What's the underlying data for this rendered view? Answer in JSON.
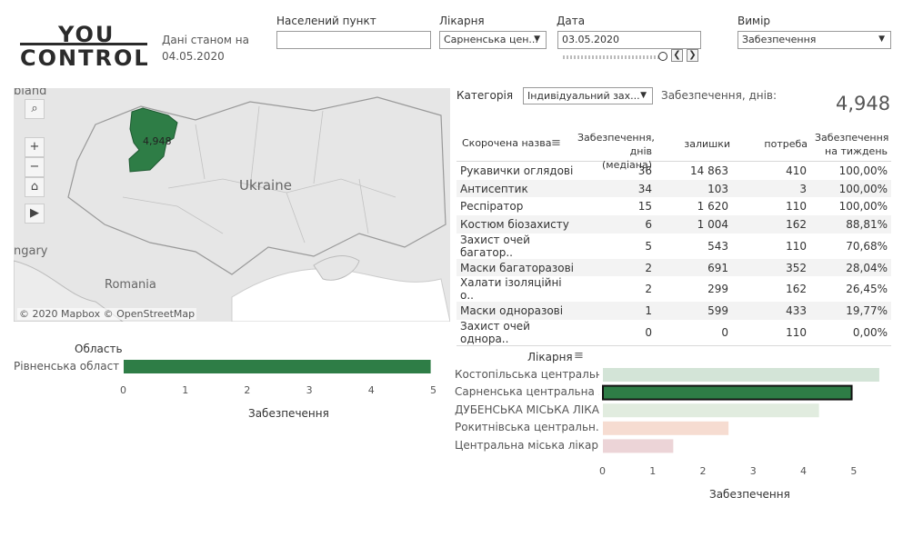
{
  "logo": {
    "line1": "YOU",
    "line2": "CONTROL"
  },
  "as_of": {
    "line1": "Дані станом на",
    "line2": "04.05.2020"
  },
  "filters": {
    "settlement": {
      "label": "Населений пункт",
      "value": ""
    },
    "hospital": {
      "label": "Лікарня",
      "value": "Сарненська цен..."
    },
    "date": {
      "label": "Дата",
      "value": "03.05.2020"
    },
    "measure": {
      "label": "Вимір",
      "value": "Забезпечення"
    },
    "date_slider_fraction": 0.95
  },
  "map": {
    "region_value": "4,948",
    "country_label": "Ukraine",
    "labels": [
      "bland",
      "Romania",
      "ngary"
    ],
    "attribution": "© 2020 Mapbox © OpenStreetMap",
    "region_color": "#2e7d46"
  },
  "category": {
    "label": "Категорія",
    "value": "Індивідуальний зах...",
    "metric_label": "Забезпечення, днів:",
    "metric_value": "4,948"
  },
  "table": {
    "headers": [
      "Скорочена назва",
      "Забезпечення, днів (медіана)",
      "залишки",
      "потреба",
      "Забезпечення на тиждень"
    ],
    "rows": [
      [
        "Рукавички оглядові",
        "36",
        "14 863",
        "410",
        "100,00%"
      ],
      [
        "Антисептик",
        "34",
        "103",
        "3",
        "100,00%"
      ],
      [
        "Респіратор",
        "15",
        "1 620",
        "110",
        "100,00%"
      ],
      [
        "Костюм біозахисту",
        "6",
        "1 004",
        "162",
        "88,81%"
      ],
      [
        "Захист очей багатор..",
        "5",
        "543",
        "110",
        "70,68%"
      ],
      [
        "Маски багаторазові",
        "2",
        "691",
        "352",
        "28,04%"
      ],
      [
        "Халати ізоляційні о..",
        "2",
        "299",
        "162",
        "26,45%"
      ],
      [
        "Маски одноразові",
        "1",
        "599",
        "433",
        "19,77%"
      ],
      [
        "Захист очей однора..",
        "0",
        "0",
        "110",
        "0,00%"
      ]
    ]
  },
  "chart_data": [
    {
      "type": "bar",
      "orientation": "horizontal",
      "title": "Область",
      "categories": [
        "Рівненська область"
      ],
      "values": [
        4.95
      ],
      "xlabel": "Забезпечення",
      "xlim": [
        0,
        5
      ],
      "ticks": [
        "0",
        "1",
        "2",
        "3",
        "4",
        "5"
      ],
      "colors": [
        "#2e7d46"
      ]
    },
    {
      "type": "bar",
      "orientation": "horizontal",
      "title": "Лікарня",
      "categories": [
        "Костопільська центральн..",
        "Сарненська центральна ..",
        "ДУБЕНСЬКА МІСЬКА ЛІКА..",
        "Рокитнівська центральн..",
        "Центральна міська лікар.."
      ],
      "values": [
        5.5,
        4.95,
        4.3,
        2.5,
        1.4
      ],
      "xlabel": "Забезпечення",
      "xlim": [
        0,
        5.7
      ],
      "ticks": [
        "0",
        "1",
        "2",
        "3",
        "4",
        "5"
      ],
      "colors": [
        "#d3e4d7",
        "#2e7d46",
        "#e1ecdf",
        "#f6dcd1",
        "#ecd4d7"
      ],
      "highlighted": "Сарненська центральна .."
    }
  ]
}
